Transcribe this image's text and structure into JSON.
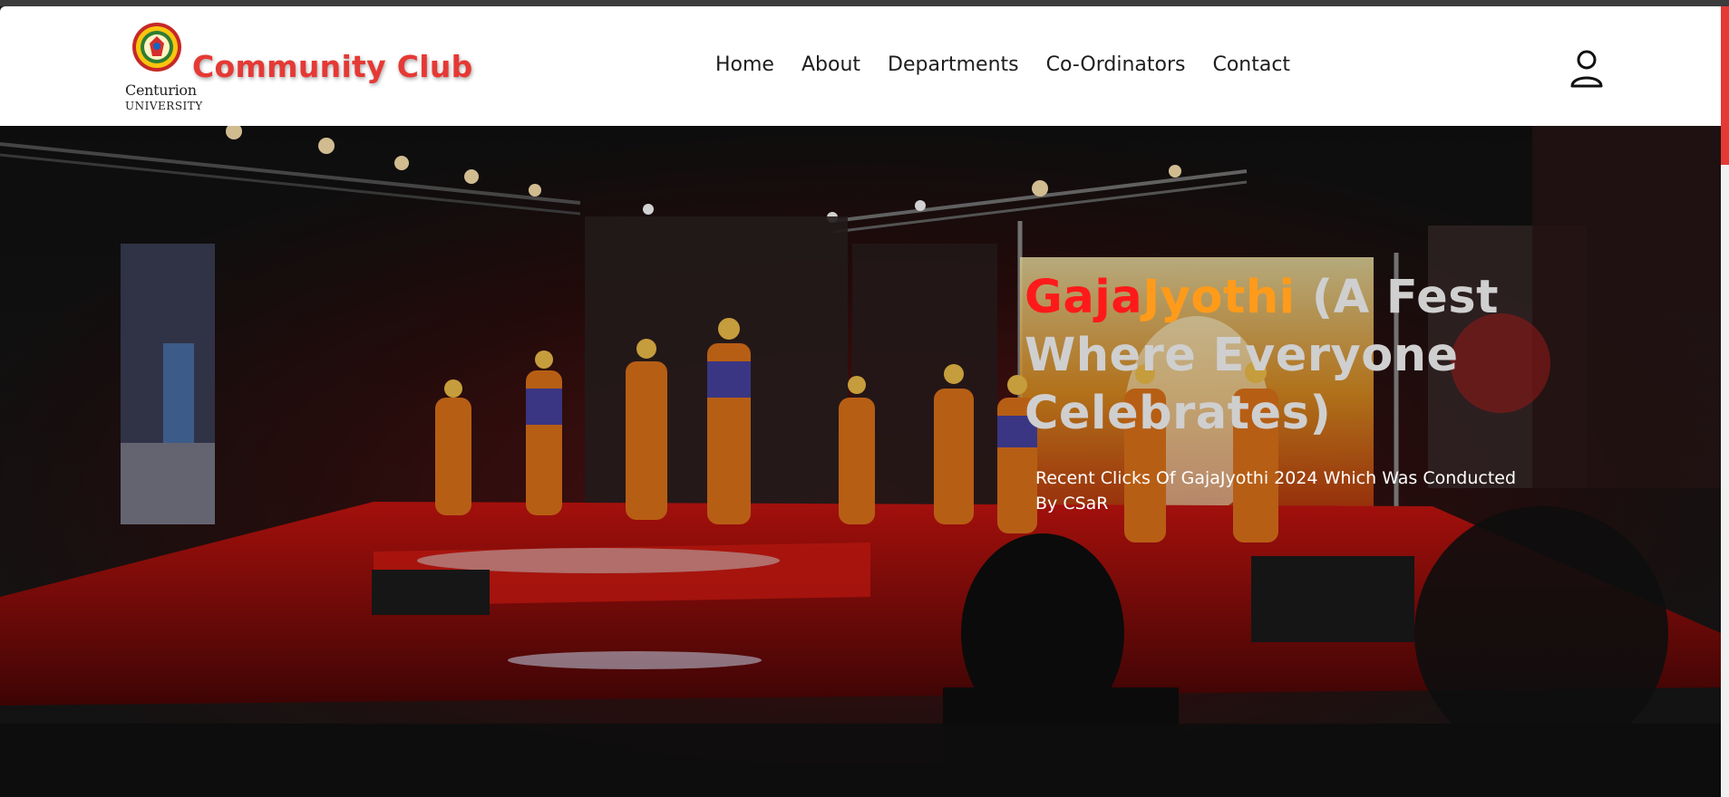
{
  "brand": {
    "logo_line1": "Centurion",
    "logo_line2": "UNIVERSITY",
    "name": "Community Club"
  },
  "nav": {
    "items": [
      "Home",
      "About",
      "Departments",
      "Co-Ordinators",
      "Contact"
    ]
  },
  "hero": {
    "title_part_red": "Gaja",
    "title_part_orange": "Jyothi",
    "title_rest": " (A Fest Where Everyone Celebrates)",
    "subtitle": "Recent Clicks Of GajaJyothi 2024 Which Was Conducted By CSaR"
  },
  "colors": {
    "accent": "#e53935",
    "title_red": "#ff1a1a",
    "title_orange": "#ff9b1a",
    "title_grey": "#cfcfcf"
  },
  "icons": {
    "user": "user-icon",
    "logo": "university-seal-icon"
  }
}
